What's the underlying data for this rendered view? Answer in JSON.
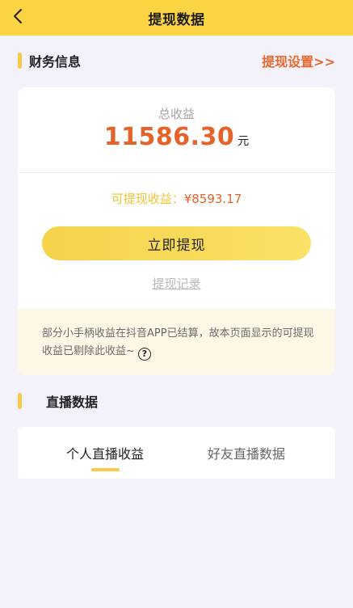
{
  "header": {
    "title": "提现数据",
    "back_icon": "chevron-left-icon"
  },
  "finance": {
    "section_title": "财务信息",
    "settings_link": "提现设置>>",
    "total_label": "总收益",
    "total_value": "11586.30",
    "total_unit": "元",
    "available_label": "可提现收益：",
    "available_value": "¥8593.17",
    "withdraw_button": "立即提现",
    "record_link": "提现记录",
    "notice_text": "部分小手柄收益在抖音APP已结算，故本页面显示的可提现收益已剔除此收益~",
    "help_icon": "question-circle-icon",
    "help_icon_char": "?"
  },
  "live": {
    "section_title": "直播数据",
    "tabs": [
      {
        "label": "个人直播收益",
        "active": true
      },
      {
        "label": "好友直播数据",
        "active": false
      }
    ]
  },
  "colors": {
    "accent": "#fbd444",
    "highlight": "#e5622a",
    "available": "#f1c232"
  }
}
